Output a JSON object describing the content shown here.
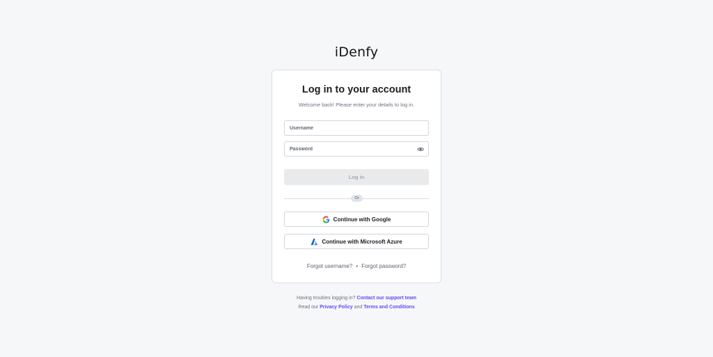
{
  "brand": {
    "logo_text": "iDenfy"
  },
  "login": {
    "title": "Log in to your account",
    "subtitle": "Welcome back! Please enter your details to log in.",
    "username_placeholder": "Username",
    "username_value": "",
    "password_placeholder": "Password",
    "password_value": "",
    "login_label": "Log in",
    "divider_label": "Or",
    "google_label": "Continue with Google",
    "azure_label": "Continue with Microsoft Azure",
    "forgot_username": "Forgot username?",
    "separator": "•",
    "forgot_password": "Forgot password?"
  },
  "footer": {
    "trouble_text": "Having troubles logging in?",
    "support_link": "Contact our support team",
    "read_text": "Read our",
    "privacy_link": "Privacy Policy",
    "and_text": "and",
    "terms_link": "Terms and Conditions"
  },
  "colors": {
    "background": "#f6f7f9",
    "link": "#5b4ef0",
    "disabled_button": "#e9eaec"
  },
  "icons": {
    "password_toggle": "eye-icon",
    "google": "google-logo-icon",
    "azure": "azure-logo-icon"
  }
}
